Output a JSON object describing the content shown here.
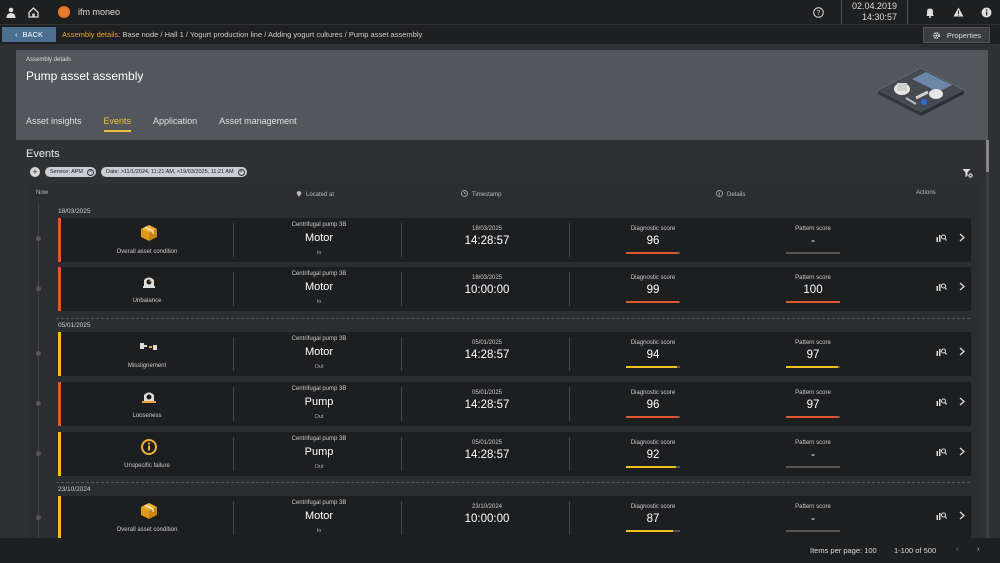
{
  "app": {
    "name": "ifm moneo",
    "date": "02.04.2019",
    "time": "14:30:57"
  },
  "breadcrumb": {
    "back_label": "BACK",
    "lead": "Assembly details:",
    "path": "Base node / Hall 1 / Yogurt production line / Adding yogurt cultures / Pump asset assembly",
    "properties_label": "Properties"
  },
  "header": {
    "subtitle": "Assembly details",
    "title": "Pump asset assembly",
    "tabs": [
      "Asset insights",
      "Events",
      "Application",
      "Asset management"
    ],
    "active_tab": "Events"
  },
  "events": {
    "title": "Events",
    "filters": [
      "Service: APM",
      "Date: >11/1/2024, 11:21 AM, <19/03/2025, 11:21 AM"
    ],
    "columns": {
      "now": "Now",
      "located": "Located at",
      "timestamp": "Timestamp",
      "details": "Details",
      "actions": "Actions"
    },
    "groups": [
      {
        "date": "18/03/2025"
      },
      {
        "date": "05/01/2025"
      },
      {
        "date": "23/10/2024"
      }
    ],
    "rows": [
      {
        "label": "Overall asset condition",
        "icon": "box-icon",
        "severity_color": "#e2562f",
        "location": "Centrifugal pump 3B",
        "component": "Motor",
        "direction": "In",
        "date": "18/03/2025",
        "time": "14:28:57",
        "diag_label": "Diagnostic score",
        "diag": "96",
        "diag_fill": 0.96,
        "diag_color": "#e2562f",
        "pattern_label": "Pattern score",
        "pattern": "-",
        "pattern_fill": 0,
        "pattern_color": "#e2562f"
      },
      {
        "label": "Unbalance",
        "icon": "unbalance-icon",
        "severity_color": "#e2562f",
        "location": "Centrifugal pump 3B",
        "component": "Motor",
        "direction": "In",
        "date": "18/03/2025",
        "time": "10:00:00",
        "diag_label": "Diagnostic score",
        "diag": "99",
        "diag_fill": 0.99,
        "diag_color": "#e2562f",
        "pattern_label": "Pattern score",
        "pattern": "100",
        "pattern_fill": 1.0,
        "pattern_color": "#e2562f"
      },
      {
        "label": "Misslignement",
        "icon": "misalignment-icon",
        "severity_color": "#f0c020",
        "location": "Centrifugal pump 3B",
        "component": "Motor",
        "direction": "Out",
        "date": "05/01/2025",
        "time": "14:28:57",
        "diag_label": "Diagnostic score",
        "diag": "94",
        "diag_fill": 0.94,
        "diag_color": "#f0c020",
        "pattern_label": "Pattern score",
        "pattern": "97",
        "pattern_fill": 0.97,
        "pattern_color": "#f0c020"
      },
      {
        "label": "Looseness",
        "icon": "looseness-icon",
        "severity_color": "#e2562f",
        "location": "Centrifugal pump 3B",
        "component": "Pump",
        "direction": "Out",
        "date": "05/01/2025",
        "time": "14:28:57",
        "diag_label": "Diagnostic score",
        "diag": "96",
        "diag_fill": 0.96,
        "diag_color": "#e2562f",
        "pattern_label": "Pattern score",
        "pattern": "97",
        "pattern_fill": 0.97,
        "pattern_color": "#e2562f"
      },
      {
        "label": "Unspecific failure",
        "icon": "info-icon",
        "severity_color": "#f0c020",
        "location": "Centrifugal pump 3B",
        "component": "Pump",
        "direction": "Out",
        "date": "05/01/2025",
        "time": "14:28:57",
        "diag_label": "Diagnostic score",
        "diag": "92",
        "diag_fill": 0.92,
        "diag_color": "#f0c020",
        "pattern_label": "Pattern score",
        "pattern": "-",
        "pattern_fill": 0,
        "pattern_color": "#f0c020"
      },
      {
        "label": "Overall asset condition",
        "icon": "box-icon",
        "severity_color": "#f0c020",
        "location": "Centrifugal pump 3B",
        "component": "Motor",
        "direction": "In",
        "date": "23/10/2024",
        "time": "10:00:00",
        "diag_label": "Diagnostic score",
        "diag": "87",
        "diag_fill": 0.87,
        "diag_color": "#f0c020",
        "pattern_label": "Pattern score",
        "pattern": "-",
        "pattern_fill": 0,
        "pattern_color": "#f0c020"
      }
    ]
  },
  "footer": {
    "items_per_page": "Items per page: 100",
    "range": "1-100 of 500"
  }
}
